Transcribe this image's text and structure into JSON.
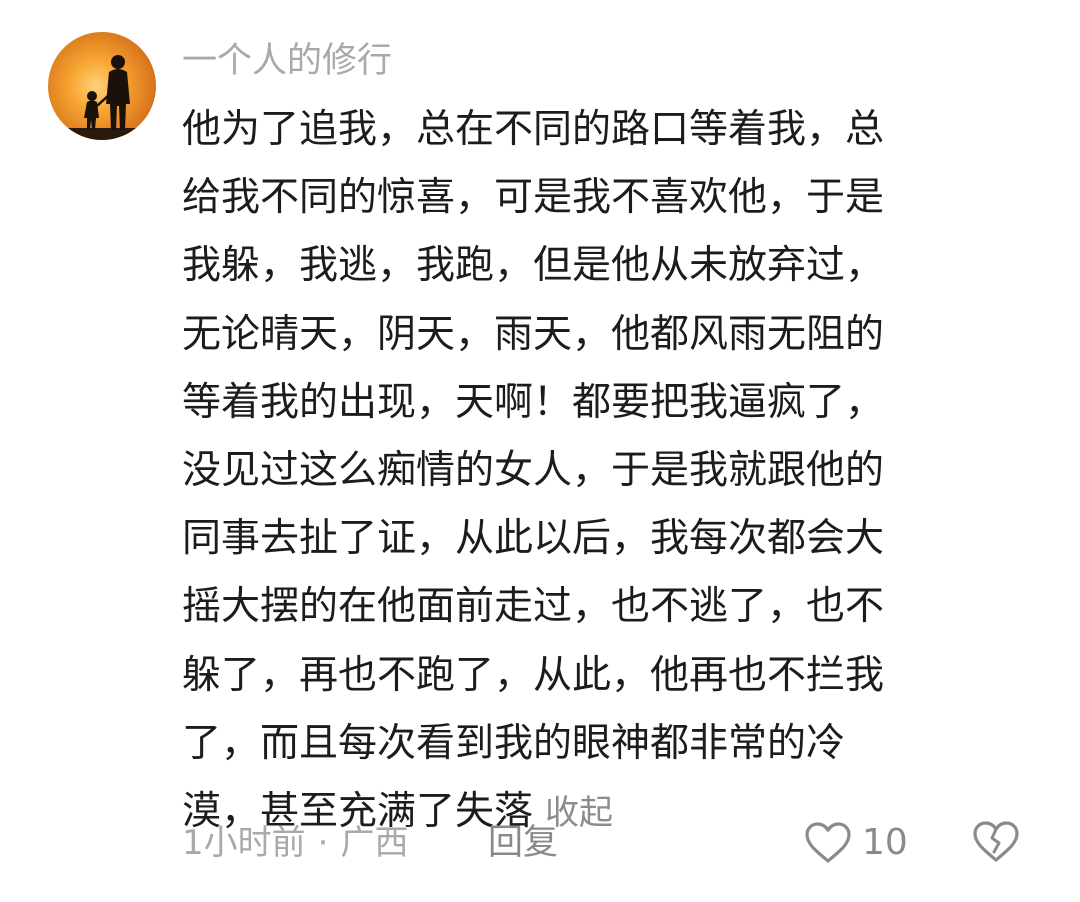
{
  "comment": {
    "username": "一个人的修行",
    "body_lines": [
      "他为了追我，总在不同的路口等着我，总",
      "给我不同的惊喜，可是我不喜欢他，于是",
      "我躲，我逃，我跑，但是他从未放弃过，",
      "无论晴天，阴天，雨天，他都风雨无阻的",
      "等着我的出现，天啊！都要把我逼疯了，",
      "没见过这么痴情的女人，于是我就跟他的",
      "同事去扯了证，从此以后，我每次都会大",
      "摇大摆的在他面前走过，也不逃了，也不",
      "躲了，再也不跑了，从此，他再也不拦我",
      "了，而且每次看到我的眼神都非常的冷",
      "漠，甚至充满了失落"
    ],
    "collapse_label": "收起",
    "time": "1小时前",
    "separator": "·",
    "location": "广西",
    "reply_label": "回复",
    "like_count": "10",
    "icons": {
      "avatar": "silhouette-sunset-avatar",
      "like": "heart-outline-icon",
      "dislike": "broken-heart-icon"
    },
    "colors": {
      "text": "#1c1c1c",
      "muted": "#a9a9a9",
      "icon": "#8a8a8a"
    }
  }
}
